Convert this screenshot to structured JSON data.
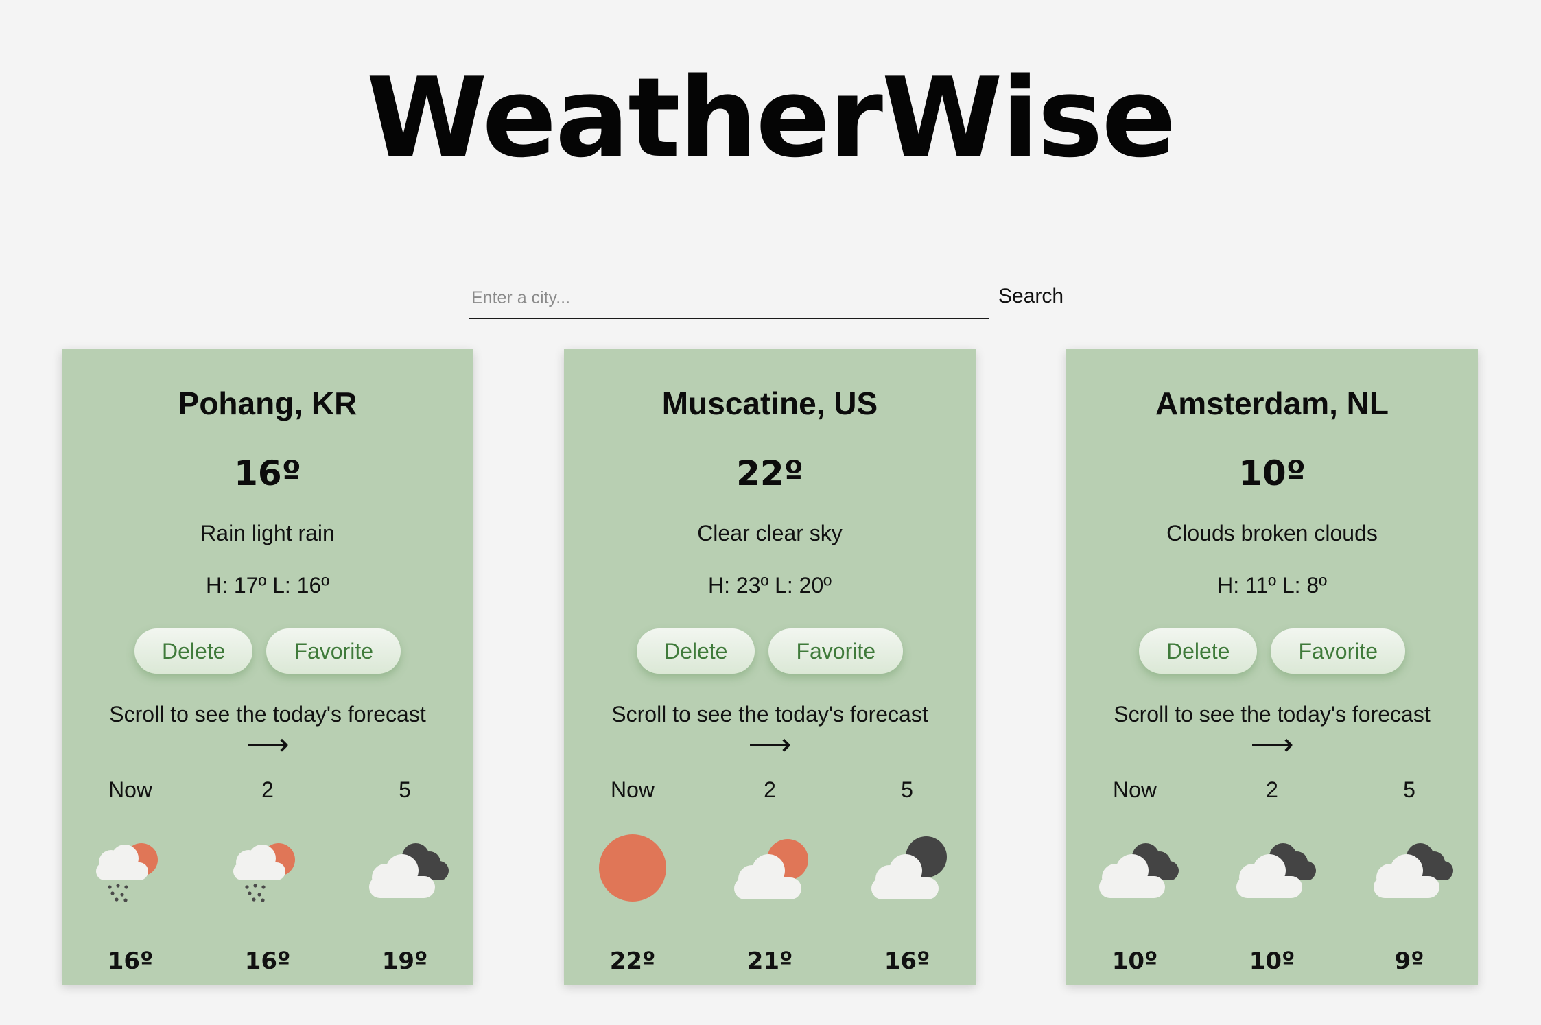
{
  "app": {
    "title": "WeatherWise"
  },
  "search": {
    "placeholder": "Enter a city...",
    "value": "",
    "button_label": "Search"
  },
  "colors": {
    "card_bg": "#b8cfb2",
    "sun": "#e07657",
    "cloud": "#f2f2f0",
    "dark_cloud": "#444444",
    "button_text": "#3f7a3a"
  },
  "cards": [
    {
      "city": "Pohang, KR",
      "temp": "16º",
      "description": "Rain light rain",
      "hilo": "H: 17º L: 16º",
      "delete_label": "Delete",
      "favorite_label": "Favorite",
      "hint": "Scroll to see the today's forecast",
      "arrow": "⟶",
      "forecast": [
        {
          "time": "Now",
          "icon": "rain-sun-icon",
          "temp": "16º"
        },
        {
          "time": "2",
          "icon": "rain-sun-icon",
          "temp": "16º"
        },
        {
          "time": "5",
          "icon": "cloud-night-icon",
          "temp": "19º"
        }
      ]
    },
    {
      "city": "Muscatine, US",
      "temp": "22º",
      "description": "Clear clear sky",
      "hilo": "H: 23º L: 20º",
      "delete_label": "Delete",
      "favorite_label": "Favorite",
      "hint": "Scroll to see the today's forecast",
      "arrow": "⟶",
      "forecast": [
        {
          "time": "Now",
          "icon": "sun-icon",
          "temp": "22º"
        },
        {
          "time": "2",
          "icon": "cloud-sun-icon",
          "temp": "21º"
        },
        {
          "time": "5",
          "icon": "cloud-moon-icon",
          "temp": "16º"
        }
      ]
    },
    {
      "city": "Amsterdam, NL",
      "temp": "10º",
      "description": "Clouds broken clouds",
      "hilo": "H: 11º L: 8º",
      "delete_label": "Delete",
      "favorite_label": "Favorite",
      "hint": "Scroll to see the today's forecast",
      "arrow": "⟶",
      "forecast": [
        {
          "time": "Now",
          "icon": "cloud-night-icon",
          "temp": "10º"
        },
        {
          "time": "2",
          "icon": "cloud-night-icon",
          "temp": "10º"
        },
        {
          "time": "5",
          "icon": "cloud-night-icon",
          "temp": "9º"
        }
      ]
    }
  ]
}
